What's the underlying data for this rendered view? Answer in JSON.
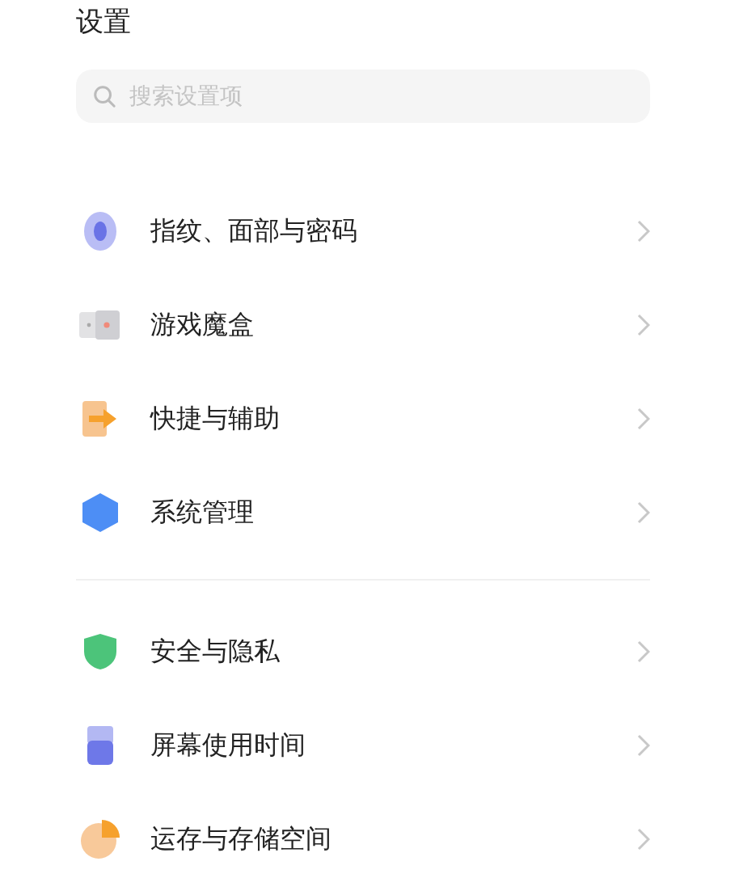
{
  "title": "设置",
  "search": {
    "placeholder": "搜索设置项"
  },
  "groups": [
    {
      "items": [
        {
          "label": "指纹、面部与密码",
          "kind": "fingerprint"
        },
        {
          "label": "游戏魔盒",
          "kind": "game"
        },
        {
          "label": "快捷与辅助",
          "kind": "shortcut"
        },
        {
          "label": "系统管理",
          "kind": "system"
        }
      ]
    },
    {
      "items": [
        {
          "label": "安全与隐私",
          "kind": "security"
        },
        {
          "label": "屏幕使用时间",
          "kind": "screentime"
        },
        {
          "label": "运存与存储空间",
          "kind": "storage"
        }
      ]
    }
  ]
}
